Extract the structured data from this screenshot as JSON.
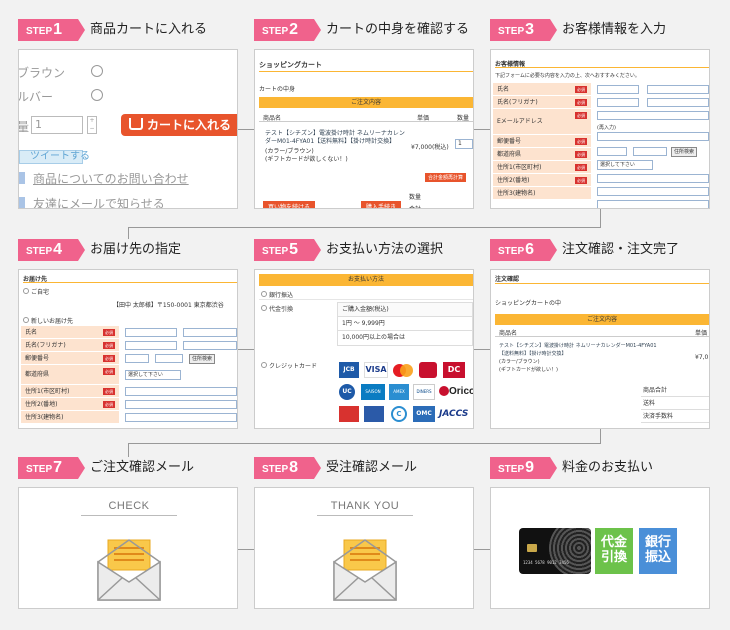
{
  "steps": [
    {
      "label": "STEP",
      "num": "1",
      "title": "商品カートに入れる"
    },
    {
      "label": "STEP",
      "num": "2",
      "title": "カートの中身を確認する"
    },
    {
      "label": "STEP",
      "num": "3",
      "title": "お客様情報を入力"
    },
    {
      "label": "STEP",
      "num": "4",
      "title": "お届け先の指定"
    },
    {
      "label": "STEP",
      "num": "5",
      "title": "お支払い方法の選択"
    },
    {
      "label": "STEP",
      "num": "6",
      "title": "注文確認・注文完了"
    },
    {
      "label": "STEP",
      "num": "7",
      "title": "ご注文確認メール"
    },
    {
      "label": "STEP",
      "num": "8",
      "title": "受注確認メール"
    },
    {
      "label": "STEP",
      "num": "9",
      "title": "料金のお支払い"
    }
  ],
  "step1": {
    "option1": "ブラウン",
    "option2": "ルバー",
    "qty_label": "量",
    "qty_value": "1",
    "cart_button": "カートに入れる",
    "tweet": "ツイートする",
    "inquiry": "商品についてのお問い合わせ",
    "tell_friend": "友達にメールで知らせる"
  },
  "step2": {
    "heading": "ショッピングカート",
    "subheading": "カートの中身",
    "order_bar": "ご注文内容",
    "col_item": "商品名",
    "col_price": "単価",
    "col_qty": "数量",
    "item_line1": "テスト【シチズン】電波掛け時計 ネムリーナカレン",
    "item_line2": "ダーM01-4FYA01【送料無料】【掛け時計交換】",
    "item_line3": "(カラー/ブラウン)",
    "item_line4": "(ギフトカードが欲しくない！)",
    "price": "¥7,000(税込)",
    "qty": "1",
    "recalc": "合計金額再計算",
    "continue": "買い物を続ける",
    "checkout": "購入手続き",
    "sub1": "数量",
    "sub2": "合計"
  },
  "step3": {
    "heading": "お客様情報",
    "note": "下記フォームに必要な内容を入力の上、次へおすすみください。",
    "fields": [
      "氏名",
      "氏名(フリガナ)",
      "Eメールアドレス",
      "郵便番号",
      "都道府県",
      "住所1(市区町村)",
      "住所2(番地)",
      "住所3(建物名)"
    ],
    "required": "必須",
    "confirm_note": "(再入力)",
    "zip_button": "住所検索",
    "select": "選択して下さい"
  },
  "step4": {
    "heading": "お届け先",
    "home": "ご自宅",
    "home_addr": "【田中 太郎様】〒150-0001 東京都渋谷",
    "new_addr": "新しいお届け先",
    "fields": [
      "氏名",
      "氏名(フリガナ)",
      "郵便番号",
      "都道府県",
      "住所1(市区町村)",
      "住所2(番地)",
      "住所3(建物名)"
    ],
    "required": "必須",
    "zip_button": "住所検索",
    "select": "選択して下さい"
  },
  "step5": {
    "bar": "お支払い方法",
    "bank": "銀行振込",
    "cod": "代金引換",
    "cod_fee_head": "ご購入金額(税込)",
    "cod_fee_row1": "1円 ～ 9,999円",
    "cod_fee_row2": "10,000円以上の場合は",
    "credit": "クレジットカード",
    "cards": [
      "JCB",
      "VISA",
      "MC",
      "",
      "DC",
      "UC",
      "SAISON",
      "AMEX",
      "DINERS",
      "Orico",
      "",
      "",
      "C",
      "OMC",
      "JACCS"
    ]
  },
  "step6": {
    "heading": "注文確認",
    "subheading": "ショッピングカートの中",
    "order_bar": "ご注文内容",
    "col_item": "商品名",
    "col_price": "単価",
    "item_line1": "テスト【シチズン】電波掛け時計 ネムリーナカレンダーM01-4FYA01",
    "item_line2": "【送料無料】【掛け時計交換】",
    "item_line3": "(カラー/ブラウン)",
    "item_line4": "(ギフトカードが欲しい！)",
    "price": "¥7,0",
    "sum1": "商品合計",
    "sum2": "送料",
    "sum3": "決済手数料"
  },
  "step7": {
    "label": "CHECK"
  },
  "step8": {
    "label": "THANK YOU"
  },
  "step9": {
    "cod": "代金引換",
    "cod_l1": "代金",
    "cod_l2": "引換",
    "bank_l1": "銀行",
    "bank_l2": "振込",
    "card_number": "1234 5678 9012 3456"
  },
  "colors": {
    "accent": "#f0628c",
    "orange": "#fbb634",
    "button": "#e8542c",
    "green": "#6cc24a",
    "blue": "#4a8fd8"
  }
}
